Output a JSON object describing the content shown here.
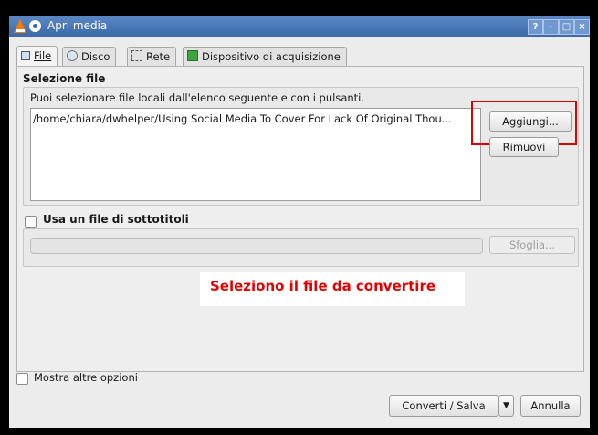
{
  "window": {
    "title": "Apri media",
    "controls": {
      "help": "?",
      "minimize": "–",
      "maximize": "□",
      "close": "×"
    }
  },
  "tabs": [
    {
      "label": "File",
      "icon": "play-file-icon",
      "active": true
    },
    {
      "label": "Disco",
      "icon": "disc-icon",
      "active": false
    },
    {
      "label": "Rete",
      "icon": "network-icon",
      "active": false
    },
    {
      "label": "Dispositivo di acquisizione",
      "icon": "capture-card-icon",
      "active": false
    }
  ],
  "file_selection": {
    "title": "Selezione file",
    "description": "Puoi selezionare file locali dall'elenco seguente e con i pulsanti.",
    "files": [
      "/home/chiara/dwhelper/Using Social Media To Cover For Lack Of Original Thou..."
    ],
    "add_button": "Aggiungi...",
    "remove_button": "Rimuovi"
  },
  "subtitles": {
    "checkbox_label": "Usa un file di sottotitoli",
    "checked": false,
    "path_value": "",
    "browse_button": "Sfoglia..."
  },
  "annotation": {
    "text": "Seleziono il file da convertire",
    "color": "#e60000"
  },
  "footer": {
    "more_options_label": "Mostra altre opzioni",
    "more_options_checked": false,
    "convert_button": "Converti / Salva",
    "cancel_button": "Annulla"
  },
  "colors": {
    "titlebar": "#3b6aa8",
    "highlight": "#e00000"
  }
}
